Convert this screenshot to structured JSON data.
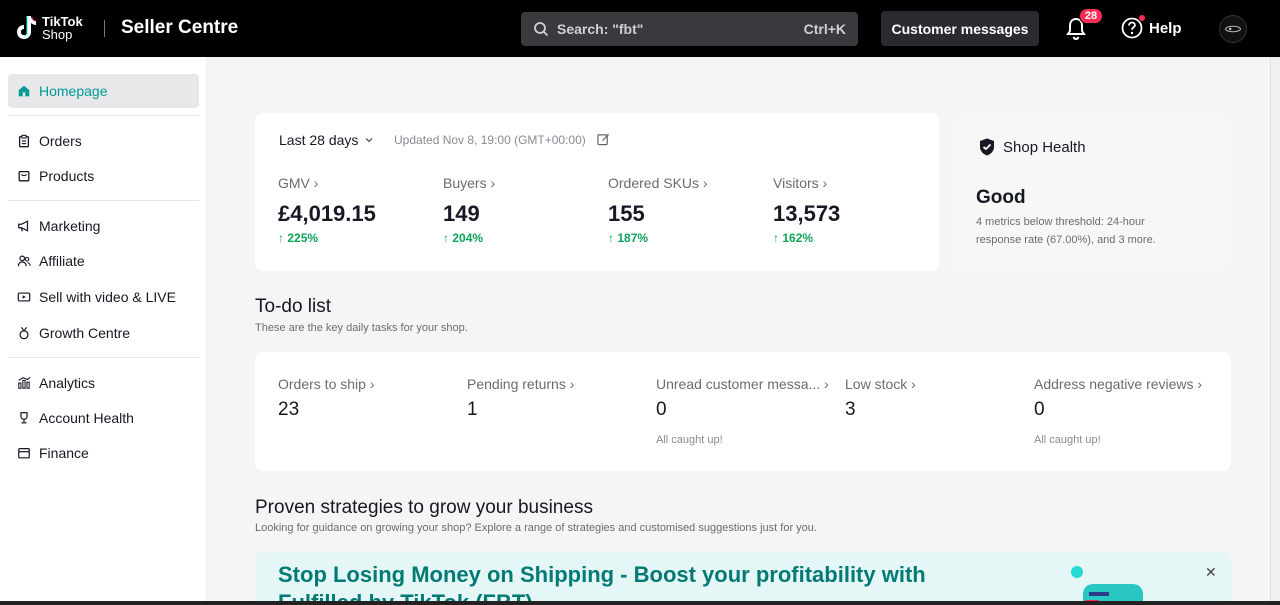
{
  "topbar": {
    "logo_line1": "TikTok",
    "logo_line2": "Shop",
    "app_title": "Seller Centre",
    "search_placeholder": "Search: \"fbt\"",
    "search_shortcut": "Ctrl+K",
    "customer_messages_label": "Customer messages",
    "notification_count": "28",
    "help_label": "Help"
  },
  "sidebar": {
    "items": [
      {
        "label": "Homepage",
        "icon": "home-icon"
      },
      {
        "label": "Orders",
        "icon": "clipboard-icon"
      },
      {
        "label": "Products",
        "icon": "box-icon"
      },
      {
        "label": "Marketing",
        "icon": "megaphone-icon"
      },
      {
        "label": "Affiliate",
        "icon": "people-icon"
      },
      {
        "label": "Sell with video & LIVE",
        "icon": "video-icon"
      },
      {
        "label": "Growth Centre",
        "icon": "medal-icon"
      },
      {
        "label": "Analytics",
        "icon": "chart-icon"
      },
      {
        "label": "Account Health",
        "icon": "trophy-icon"
      },
      {
        "label": "Finance",
        "icon": "wallet-icon"
      }
    ]
  },
  "overview": {
    "period": "Last 28 days",
    "updated": "Updated Nov 8, 19:00 (GMT+00:00)",
    "metrics": [
      {
        "label": "GMV",
        "value": "£4,019.15",
        "delta": "225%"
      },
      {
        "label": "Buyers",
        "value": "149",
        "delta": "204%"
      },
      {
        "label": "Ordered SKUs",
        "value": "155",
        "delta": "187%"
      },
      {
        "label": "Visitors",
        "value": "13,573",
        "delta": "162%"
      }
    ]
  },
  "shop_health": {
    "title": "Shop Health",
    "status": "Good",
    "detail_line1": "4 metrics below threshold: 24-hour",
    "detail_line2": "response rate (67.00%), and 3 more."
  },
  "todo": {
    "title": "To-do list",
    "subtitle": "These are the key daily tasks for your shop.",
    "items": [
      {
        "label": "Orders to ship",
        "value": "23",
        "note": ""
      },
      {
        "label": "Pending returns",
        "value": "1",
        "note": ""
      },
      {
        "label": "Unread customer messa...",
        "value": "0",
        "note": "All caught up!"
      },
      {
        "label": "Low stock",
        "value": "3",
        "note": ""
      },
      {
        "label": "Address negative reviews",
        "value": "0",
        "note": "All caught up!"
      }
    ]
  },
  "strategies": {
    "title": "Proven strategies to grow your business",
    "subtitle": "Looking for guidance on growing your shop? Explore a range of strategies and customised suggestions just for you.",
    "banner_line1": "Stop Losing Money on Shipping - Boost your profitability with",
    "banner_line2": "Fulfilled by TikTok (FBT)"
  },
  "colors": {
    "accent": "#009995",
    "positive": "#0fa35a",
    "badge": "#fe2c55",
    "banner_bg": "#e4f7f6"
  }
}
